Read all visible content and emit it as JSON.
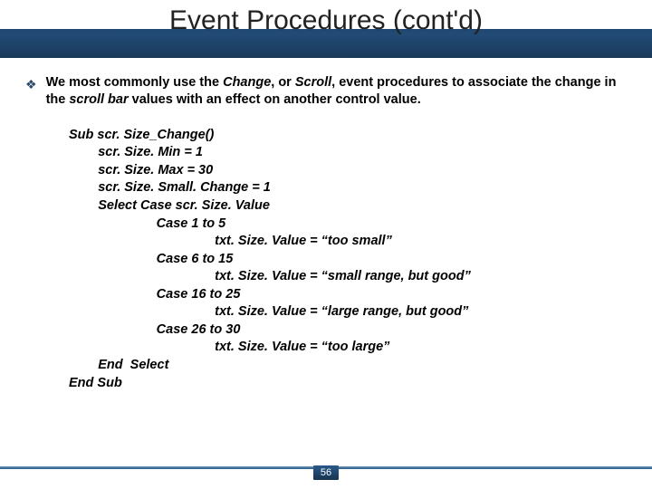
{
  "slide": {
    "title": "Event Procedures (cont'd)",
    "bullet": {
      "pre": "We most commonly use the ",
      "em1": "Change",
      "mid1": ", or ",
      "em2": "Scroll",
      "mid2": ", event procedures to associate the change in the ",
      "em3": "scroll bar",
      "post": " values with an effect on another control value."
    },
    "code": "Sub scr. Size_Change()\n        scr. Size. Min = 1\n        scr. Size. Max = 30\n        scr. Size. Small. Change = 1\n        Select Case scr. Size. Value\n                        Case 1 to 5\n                                        txt. Size. Value = “too small”\n                        Case 6 to 15\n                                        txt. Size. Value = “small range, but good”\n                        Case 16 to 25\n                                        txt. Size. Value = “large range, but good”\n                        Case 26 to 30\n                                        txt. Size. Value = “too large”\n        End  Select\nEnd Sub",
    "page_number": "56"
  }
}
